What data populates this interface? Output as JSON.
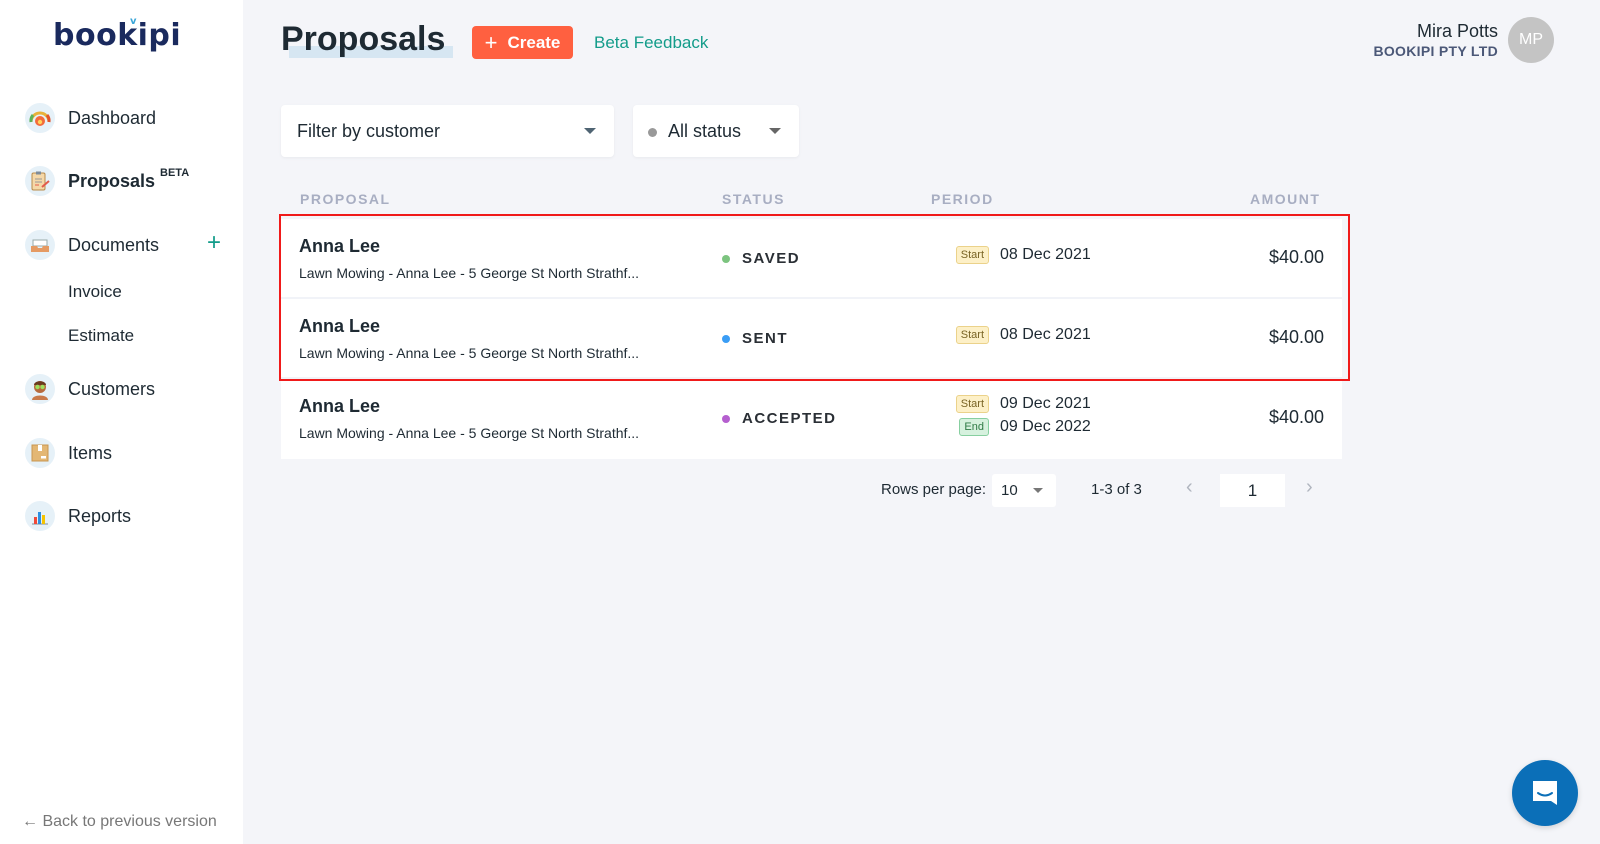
{
  "app": {
    "logo": "bookipi"
  },
  "sidebar": {
    "items": [
      {
        "label": "Dashboard",
        "icon": "dashboard-gauge-icon"
      },
      {
        "label": "Proposals",
        "badge": "BETA",
        "icon": "clipboard-icon",
        "active": true
      },
      {
        "label": "Documents",
        "icon": "inbox-tray-icon",
        "action_icon": "plus-icon"
      },
      {
        "label": "Customers",
        "icon": "customer-avatar-icon"
      },
      {
        "label": "Items",
        "icon": "box-icon"
      },
      {
        "label": "Reports",
        "icon": "bar-chart-icon"
      }
    ],
    "sub_items": [
      {
        "label": "Invoice"
      },
      {
        "label": "Estimate"
      }
    ],
    "back_link": "Back to previous version"
  },
  "header": {
    "title": "Proposals",
    "create_label": "Create",
    "feedback_label": "Beta Feedback",
    "user": {
      "name": "Mira Potts",
      "company": "BOOKIPI PTY LTD",
      "initials": "MP"
    }
  },
  "filters": {
    "customer": {
      "value": "Filter by customer"
    },
    "status": {
      "value": "All status"
    }
  },
  "table": {
    "columns": [
      "PROPOSAL",
      "STATUS",
      "PERIOD",
      "AMOUNT"
    ],
    "rows": [
      {
        "customer": "Anna Lee",
        "description": "Lawn Mowing - Anna Lee - 5 George St North Strathf...",
        "status": "SAVED",
        "status_color": "#7cc47f",
        "period": [
          {
            "tag": "Start",
            "date": "08 Dec 2021"
          }
        ],
        "amount": "$40.00"
      },
      {
        "customer": "Anna Lee",
        "description": "Lawn Mowing - Anna Lee - 5 George St North Strathf...",
        "status": "SENT",
        "status_color": "#3a9df5",
        "period": [
          {
            "tag": "Start",
            "date": "08 Dec 2021"
          }
        ],
        "amount": "$40.00"
      },
      {
        "customer": "Anna Lee",
        "description": "Lawn Mowing - Anna Lee - 5 George St North Strathf...",
        "status": "ACCEPTED",
        "status_color": "#b55fcf",
        "period": [
          {
            "tag": "Start",
            "date": "09 Dec 2021"
          },
          {
            "tag": "End",
            "date": "09 Dec 2022"
          }
        ],
        "amount": "$40.00"
      }
    ]
  },
  "pagination": {
    "rows_per_page_label": "Rows per page:",
    "rows_per_page": "10",
    "range": "1-3 of 3",
    "current_page": "1",
    "prev": "‹",
    "next": "›"
  },
  "colors": {
    "accent": "#ff6040",
    "link": "#139c8a",
    "chat": "#0b6fb8",
    "highlight": "#f01a1a"
  }
}
